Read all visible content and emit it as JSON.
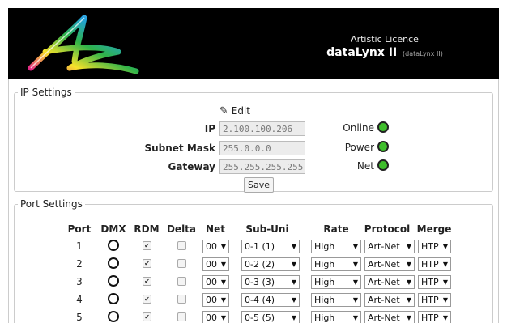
{
  "header": {
    "company": "Artistic Licence",
    "product": "dataLynx II",
    "product_sub": "(dataLynx II)"
  },
  "ip_settings": {
    "legend": "IP Settings",
    "edit_label": "Edit",
    "ip_label": "IP",
    "ip_value": "2.100.100.206",
    "mask_label": "Subnet Mask",
    "mask_value": "255.0.0.0",
    "gateway_label": "Gateway",
    "gateway_value": "255.255.255.255",
    "save_label": "Save",
    "status": [
      {
        "label": "Online",
        "color": "#3fbe2c"
      },
      {
        "label": "Power",
        "color": "#3fbe2c"
      },
      {
        "label": "Net",
        "color": "#3fbe2c"
      }
    ]
  },
  "port_settings": {
    "legend": "Port Settings",
    "columns": [
      "Port",
      "DMX",
      "RDM",
      "Delta",
      "Net",
      "Sub-Uni",
      "Rate",
      "Protocol",
      "Merge"
    ],
    "rows": [
      {
        "port": "1",
        "rdm": true,
        "delta": false,
        "net": "00",
        "subuni": "0-1 (1)",
        "rate": "High",
        "protocol": "Art-Net",
        "merge": "HTP"
      },
      {
        "port": "2",
        "rdm": true,
        "delta": false,
        "net": "00",
        "subuni": "0-2 (2)",
        "rate": "High",
        "protocol": "Art-Net",
        "merge": "HTP"
      },
      {
        "port": "3",
        "rdm": true,
        "delta": false,
        "net": "00",
        "subuni": "0-3 (3)",
        "rate": "High",
        "protocol": "Art-Net",
        "merge": "HTP"
      },
      {
        "port": "4",
        "rdm": true,
        "delta": false,
        "net": "00",
        "subuni": "0-4 (4)",
        "rate": "High",
        "protocol": "Art-Net",
        "merge": "HTP"
      },
      {
        "port": "5",
        "rdm": true,
        "delta": false,
        "net": "00",
        "subuni": "0-5 (5)",
        "rate": "High",
        "protocol": "Art-Net",
        "merge": "HTP"
      }
    ]
  }
}
